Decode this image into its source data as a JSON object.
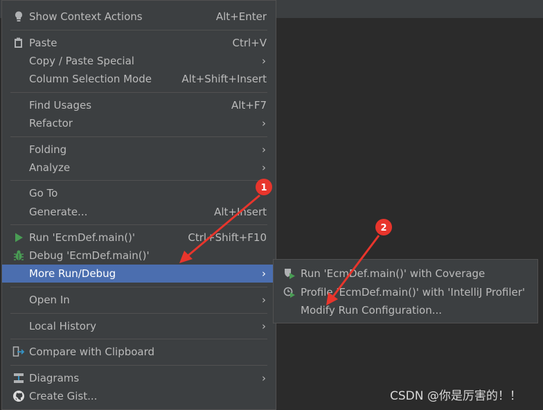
{
  "menu": {
    "show_context_actions": {
      "label": "Show Context Actions",
      "shortcut": "Alt+Enter"
    },
    "paste": {
      "label": "Paste",
      "shortcut": "Ctrl+V"
    },
    "copy_paste_special": {
      "label": "Copy / Paste Special"
    },
    "column_selection": {
      "label": "Column Selection Mode",
      "shortcut": "Alt+Shift+Insert"
    },
    "find_usages": {
      "label": "Find Usages",
      "shortcut": "Alt+F7"
    },
    "refactor": {
      "label": "Refactor"
    },
    "folding": {
      "label": "Folding"
    },
    "analyze": {
      "label": "Analyze"
    },
    "go_to": {
      "label": "Go To"
    },
    "generate": {
      "label": "Generate...",
      "shortcut": "Alt+Insert"
    },
    "run": {
      "label": "Run 'EcmDef.main()'",
      "shortcut": "Ctrl+Shift+F10"
    },
    "debug": {
      "label": "Debug 'EcmDef.main()'"
    },
    "more_run_debug": {
      "label": "More Run/Debug"
    },
    "open_in": {
      "label": "Open In"
    },
    "local_history": {
      "label": "Local History"
    },
    "compare_clipboard": {
      "label": "Compare with Clipboard"
    },
    "diagrams": {
      "label": "Diagrams"
    },
    "create_gist": {
      "label": "Create Gist..."
    }
  },
  "submenu": {
    "run_coverage": {
      "label": "Run 'EcmDef.main()' with Coverage"
    },
    "profile": {
      "label": "Profile 'EcmDef.main()' with 'IntelliJ Profiler'"
    },
    "modify_config": {
      "label": "Modify Run Configuration..."
    }
  },
  "annotations": {
    "badge1": "1",
    "badge2": "2"
  },
  "watermark": "CSDN @你是厉害的！！",
  "colors": {
    "selection": "#4b6eaf",
    "menu_bg": "#3c3f41",
    "arrow": "#e8352c"
  }
}
